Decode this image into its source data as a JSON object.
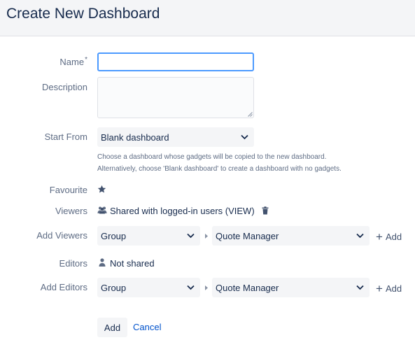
{
  "page": {
    "title": "Create New Dashboard"
  },
  "form": {
    "name": {
      "label": "Name",
      "required_marker": "*",
      "value": ""
    },
    "description": {
      "label": "Description",
      "value": ""
    },
    "start_from": {
      "label": "Start From",
      "selected": "Blank dashboard",
      "help_line1": "Choose a dashboard whose gadgets will be copied to the new dashboard.",
      "help_line2": "Alternatively, choose 'Blank dashboard' to create a dashboard with no gadgets."
    },
    "favourite": {
      "label": "Favourite",
      "icon": "star-icon",
      "state": "starred"
    },
    "viewers": {
      "label": "Viewers",
      "icon": "users-icon",
      "text": "Shared with logged-in users (VIEW)",
      "delete_icon": "trash-icon"
    },
    "add_viewers": {
      "label": "Add Viewers",
      "type_selected": "Group",
      "value_selected": "Quote Manager",
      "add_label": "Add"
    },
    "editors": {
      "label": "Editors",
      "icon": "user-icon",
      "text": "Not shared"
    },
    "add_editors": {
      "label": "Add Editors",
      "type_selected": "Group",
      "value_selected": "Quote Manager",
      "add_label": "Add"
    }
  },
  "actions": {
    "submit_label": "Add",
    "cancel_label": "Cancel"
  },
  "colors": {
    "focus_border": "#4c9aff",
    "link": "#0052cc",
    "label": "#5e6c84",
    "field_bg": "#f4f5f7"
  }
}
